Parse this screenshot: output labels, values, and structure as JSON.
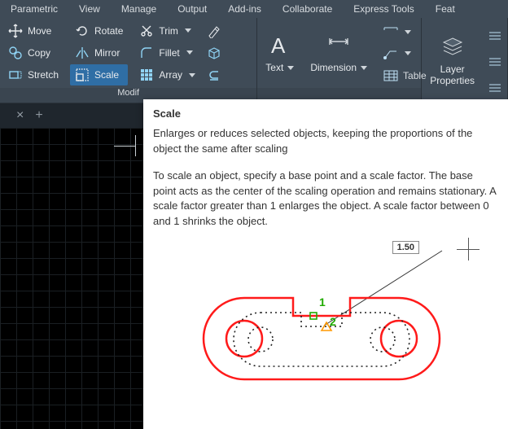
{
  "menubar": [
    "Parametric",
    "View",
    "Manage",
    "Output",
    "Add-ins",
    "Collaborate",
    "Express Tools",
    "Feat"
  ],
  "modify": {
    "label": "Modif",
    "move": "Move",
    "copy": "Copy",
    "stretch": "Stretch",
    "rotate": "Rotate",
    "mirror": "Mirror",
    "scale": "Scale",
    "trim": "Trim",
    "fillet": "Fillet",
    "array": "Array"
  },
  "annotation": {
    "text": "Text",
    "dimension": "Dimension",
    "table": "Table"
  },
  "layers": {
    "label": "Layer",
    "properties": "Properties"
  },
  "tooltip": {
    "title": "Scale",
    "p1": "Enlarges or reduces selected objects, keeping the proportions of the object the same after scaling",
    "p2": "To scale an object, specify a base point and a scale factor. The base point acts as the center of the scaling operation and remains stationary. A scale factor greater than 1 enlarges the object. A scale factor between 0 and 1 shrinks the object.",
    "scale_value": "1.50",
    "marker1": "1",
    "marker2": "2"
  }
}
